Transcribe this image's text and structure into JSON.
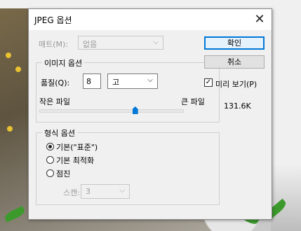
{
  "dialog": {
    "title": "JPEG 옵션",
    "matte": {
      "label": "매트(M):",
      "value": "없음"
    },
    "image_options": {
      "title": "이미지 옵션",
      "quality_label": "품질(Q):",
      "quality_value": "8",
      "quality_preset": "고",
      "small_file_label": "작은 파일",
      "large_file_label": "큰 파일",
      "slider_level_fraction": 0.67
    },
    "format_options": {
      "title": "형식 옵션",
      "options": [
        "기본(\"표준\")",
        "기본 최적화",
        "점진"
      ],
      "selected_index": 0,
      "scan_label": "스캔:",
      "scan_value": "3"
    },
    "buttons": {
      "ok": "확인",
      "cancel": "취소"
    },
    "preview": {
      "label": "미리 보기(P)",
      "checked": true
    },
    "file_size": "131.6K"
  }
}
